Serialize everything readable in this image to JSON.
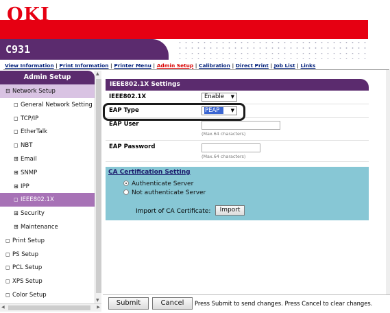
{
  "brand": {
    "logo": "OKI",
    "model": "C931"
  },
  "nav": {
    "items": [
      "View Information",
      "Print Information",
      "Printer Menu",
      "Admin Setup",
      "Calibration",
      "Direct Print",
      "Job List",
      "Links"
    ],
    "separator": " | ",
    "active": "Admin Setup"
  },
  "sidebar": {
    "header": "Admin Setup",
    "items": [
      {
        "label": "Network Setup",
        "marker": "⊟"
      },
      {
        "label": "General Network Setting",
        "marker": "◻"
      },
      {
        "label": "TCP/IP",
        "marker": "◻"
      },
      {
        "label": "EtherTalk",
        "marker": "◻"
      },
      {
        "label": "NBT",
        "marker": "◻"
      },
      {
        "label": "Email",
        "marker": "⊞"
      },
      {
        "label": "SNMP",
        "marker": "⊞"
      },
      {
        "label": "IPP",
        "marker": "⊞"
      },
      {
        "label": "IEEE802.1X",
        "marker": "◻"
      },
      {
        "label": "Security",
        "marker": "⊞"
      },
      {
        "label": "Maintenance",
        "marker": "⊞"
      },
      {
        "label": "Print Setup",
        "marker": "◻"
      },
      {
        "label": "PS Setup",
        "marker": "◻"
      },
      {
        "label": "PCL Setup",
        "marker": "◻"
      },
      {
        "label": "XPS Setup",
        "marker": "◻"
      },
      {
        "label": "Color Setup",
        "marker": "◻"
      }
    ]
  },
  "panel": {
    "title": "IEEE802.1X Settings",
    "ieee_label": "IEEE802.1X",
    "ieee_value": "Enable",
    "eap_type_label": "EAP Type",
    "eap_type_value": "PEAP",
    "eap_user_label": "EAP User",
    "eap_user_value": "",
    "eap_user_hint": "(Max.64 characters)",
    "eap_password_label": "EAP Password",
    "eap_password_value": "",
    "eap_password_hint": "(Max.64 characters)"
  },
  "ca": {
    "title": "CA Certification Setting",
    "option_auth": "Authenticate Server",
    "option_no_auth": "Not authenticate Server",
    "selected": "Authenticate Server",
    "import_label": "Import of CA Certificate:",
    "import_button": "Import"
  },
  "footer": {
    "submit": "Submit",
    "cancel": "Cancel",
    "message": "Press Submit to send changes. Press Cancel to clear changes."
  },
  "colors": {
    "brand_red": "#e60012",
    "purple": "#5b2b6e",
    "selected_item": "#a772b6",
    "group_bg": "#d9c3e3",
    "ca_bg": "#87c7d5"
  },
  "icons": {
    "dropdown": "chevron-down-icon",
    "collapse": "minus-box-icon",
    "expand": "plus-box-icon",
    "bullet": "square-bullet-icon"
  }
}
